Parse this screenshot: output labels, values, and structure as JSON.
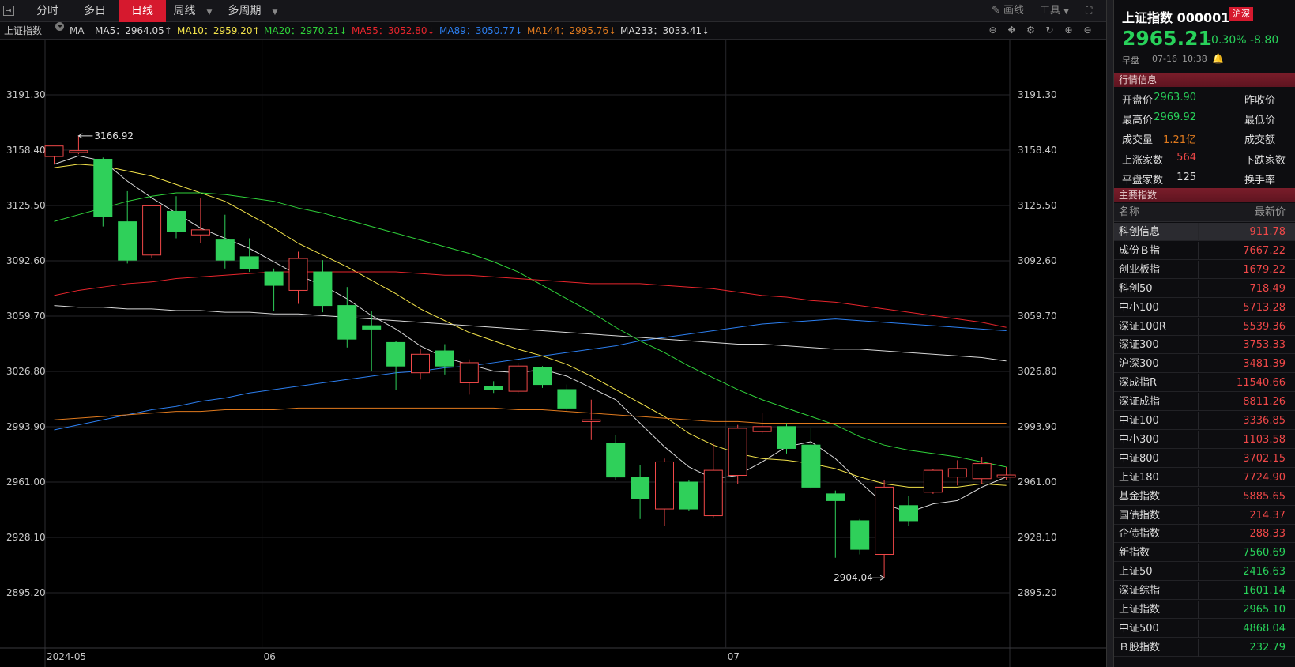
{
  "toolbar": {
    "tabs": [
      {
        "label": "分时",
        "active": false
      },
      {
        "label": "多日",
        "active": false
      },
      {
        "label": "日线",
        "active": true
      },
      {
        "label": "周线",
        "active": false
      },
      {
        "label": "多周期",
        "active": false
      }
    ],
    "draw_label": "画线",
    "tools_label": "工具"
  },
  "mabar": {
    "index_name": "上证指数",
    "ma_label": "MA",
    "items": [
      {
        "label": "MA5：2964.05↑",
        "color": "#d8d8d8",
        "arrow": "up"
      },
      {
        "label": "MA10：2959.20↑",
        "color": "#f2e24a",
        "arrow": "up"
      },
      {
        "label": "MA20：2970.21↓",
        "color": "#2fd23a",
        "arrow": "down"
      },
      {
        "label": "MA55：3052.80↓",
        "color": "#e8252c",
        "arrow": "down"
      },
      {
        "label": "MA89：3050.77↓",
        "color": "#2c7ff0",
        "arrow": "down"
      },
      {
        "label": "MA144：2995.76↓",
        "color": "#e07a1e",
        "arrow": "down"
      },
      {
        "label": "MA233：3033.41↓",
        "color": "#d8d8d8",
        "arrow": "down"
      }
    ]
  },
  "chart_data": {
    "type": "candlestick",
    "ylim": [
      2862.3,
      3224.2
    ],
    "y_ticks": [
      "3191.30",
      "3158.40",
      "3125.50",
      "3092.60",
      "3059.70",
      "3026.80",
      "2993.90",
      "2961.00",
      "2928.10",
      "2895.20"
    ],
    "y_tick_values": [
      3191.3,
      3158.4,
      3125.5,
      3092.6,
      3059.7,
      3026.8,
      2993.9,
      2961.0,
      2928.1,
      2895.2
    ],
    "x_labels": [
      {
        "label": "2024-05",
        "index": 0
      },
      {
        "label": "06",
        "index": 9
      },
      {
        "label": "07",
        "index": 28
      }
    ],
    "max_annotation": {
      "label": "3166.92",
      "index": 1,
      "value": 3166.92
    },
    "min_annotation": {
      "label": "2904.04",
      "index": 34,
      "value": 2904.04
    },
    "candles": [
      {
        "o": 3154.6,
        "c": 3160.9,
        "h": 3161.0,
        "l": 3150.1
      },
      {
        "o": 3157.0,
        "c": 3158.1,
        "h": 3166.92,
        "l": 3156.0
      },
      {
        "o": 3153.0,
        "c": 3119.0,
        "h": 3154.0,
        "l": 3113.0
      },
      {
        "o": 3115.8,
        "c": 3093.0,
        "h": 3134.0,
        "l": 3091.0
      },
      {
        "o": 3096.0,
        "c": 3125.3,
        "h": 3125.8,
        "l": 3094.0
      },
      {
        "o": 3122.0,
        "c": 3110.0,
        "h": 3131.0,
        "l": 3106.0
      },
      {
        "o": 3108.0,
        "c": 3111.0,
        "h": 3130.0,
        "l": 3103.0
      },
      {
        "o": 3105.0,
        "c": 3093.0,
        "h": 3120.0,
        "l": 3088.0
      },
      {
        "o": 3095.0,
        "c": 3088.0,
        "h": 3106.0,
        "l": 3086.0
      },
      {
        "o": 3086.0,
        "c": 3078.0,
        "h": 3088.0,
        "l": 3063.0
      },
      {
        "o": 3075.0,
        "c": 3094.0,
        "h": 3098.0,
        "l": 3067.0
      },
      {
        "o": 3086.0,
        "c": 3066.0,
        "h": 3093.0,
        "l": 3062.0
      },
      {
        "o": 3066.0,
        "c": 3046.0,
        "h": 3077.0,
        "l": 3041.0
      },
      {
        "o": 3054.0,
        "c": 3052.0,
        "h": 3063.0,
        "l": 3027.0
      },
      {
        "o": 3044.0,
        "c": 3030.0,
        "h": 3045.0,
        "l": 3016.0
      },
      {
        "o": 3026.0,
        "c": 3037.0,
        "h": 3040.0,
        "l": 3022.0
      },
      {
        "o": 3039.0,
        "c": 3030.0,
        "h": 3043.0,
        "l": 3025.0
      },
      {
        "o": 3020.0,
        "c": 3032.0,
        "h": 3034.0,
        "l": 3013.0
      },
      {
        "o": 3018.0,
        "c": 3016.0,
        "h": 3021.0,
        "l": 3014.0
      },
      {
        "o": 3015.0,
        "c": 3030.0,
        "h": 3032.0,
        "l": 3014.0
      },
      {
        "o": 3029.0,
        "c": 3019.0,
        "h": 3030.0,
        "l": 3017.0
      },
      {
        "o": 3016.0,
        "c": 3005.0,
        "h": 3019.0,
        "l": 3003.0
      },
      {
        "o": 2997.0,
        "c": 2998.0,
        "h": 3010.0,
        "l": 2986.0
      },
      {
        "o": 2984.0,
        "c": 2964.0,
        "h": 2989.0,
        "l": 2962.0
      },
      {
        "o": 2964.0,
        "c": 2951.0,
        "h": 2971.0,
        "l": 2939.0
      },
      {
        "o": 2945.0,
        "c": 2973.0,
        "h": 2975.0,
        "l": 2935.0
      },
      {
        "o": 2961.0,
        "c": 2945.0,
        "h": 2962.0,
        "l": 2944.0
      },
      {
        "o": 2941.0,
        "c": 2968.0,
        "h": 2984.0,
        "l": 2940.0
      },
      {
        "o": 2965.0,
        "c": 2993.0,
        "h": 2995.0,
        "l": 2960.0
      },
      {
        "o": 2991.0,
        "c": 2994.0,
        "h": 3002.0,
        "l": 2990.0
      },
      {
        "o": 2994.0,
        "c": 2981.0,
        "h": 2996.0,
        "l": 2978.0
      },
      {
        "o": 2983.0,
        "c": 2958.0,
        "h": 2993.0,
        "l": 2957.0
      },
      {
        "o": 2954.0,
        "c": 2950.0,
        "h": 2956.0,
        "l": 2916.0
      },
      {
        "o": 2938.0,
        "c": 2921.0,
        "h": 2939.0,
        "l": 2918.0
      },
      {
        "o": 2918.0,
        "c": 2958.0,
        "h": 2962.0,
        "l": 2904.04
      },
      {
        "o": 2947.0,
        "c": 2938.0,
        "h": 2953.0,
        "l": 2935.0
      },
      {
        "o": 2955.0,
        "c": 2968.0,
        "h": 2969.0,
        "l": 2954.0
      },
      {
        "o": 2964.0,
        "c": 2969.0,
        "h": 2974.0,
        "l": 2959.0
      },
      {
        "o": 2963.0,
        "c": 2972.0,
        "h": 2976.0,
        "l": 2960.0
      },
      {
        "o": 2963.9,
        "c": 2965.21,
        "h": 2969.92,
        "l": 2962.0
      }
    ],
    "ma_lines": [
      {
        "name": "MA5",
        "color": "#d8d8d8",
        "values": [
          3150,
          3155,
          3152,
          3140,
          3130,
          3121,
          3112,
          3106,
          3100,
          3092,
          3084,
          3078,
          3070,
          3060,
          3052,
          3042,
          3035,
          3031,
          3027,
          3026,
          3028,
          3024,
          3017,
          3010,
          2996,
          2982,
          2970,
          2963,
          2965,
          2973,
          2982,
          2985,
          2975,
          2961,
          2948,
          2943,
          2948,
          2950,
          2958,
          2964
        ]
      },
      {
        "name": "MA10",
        "color": "#f2e24a",
        "values": [
          3148,
          3150,
          3149,
          3146,
          3143,
          3138,
          3133,
          3128,
          3120,
          3112,
          3103,
          3096,
          3089,
          3081,
          3073,
          3064,
          3057,
          3050,
          3045,
          3040,
          3036,
          3031,
          3024,
          3016,
          3008,
          3000,
          2990,
          2983,
          2978,
          2975,
          2974,
          2972,
          2969,
          2964,
          2960,
          2958,
          2958,
          2958,
          2960,
          2959
        ]
      },
      {
        "name": "MA20",
        "color": "#2fd23a",
        "values": [
          3116,
          3120,
          3124,
          3128,
          3131,
          3133,
          3133,
          3132,
          3130,
          3128,
          3124,
          3121,
          3117,
          3113,
          3109,
          3105,
          3101,
          3097,
          3092,
          3086,
          3078,
          3070,
          3062,
          3053,
          3045,
          3038,
          3030,
          3023,
          3016,
          3010,
          3005,
          3000,
          2995,
          2988,
          2983,
          2980,
          2978,
          2976,
          2973,
          2970
        ]
      },
      {
        "name": "MA55",
        "color": "#e8252c",
        "values": [
          3072,
          3075,
          3077,
          3079,
          3080,
          3082,
          3083,
          3084,
          3085,
          3086,
          3086,
          3086,
          3086,
          3086,
          3086,
          3085,
          3084,
          3084,
          3083,
          3082,
          3081,
          3080,
          3079,
          3079,
          3079,
          3078,
          3077,
          3076,
          3074,
          3072,
          3071,
          3069,
          3068,
          3066,
          3064,
          3062,
          3060,
          3058,
          3056,
          3053
        ]
      },
      {
        "name": "MA89",
        "color": "#2c7ff0",
        "values": [
          2992,
          2995,
          2998,
          3001,
          3004,
          3006,
          3009,
          3011,
          3014,
          3016,
          3018,
          3020,
          3022,
          3024,
          3026,
          3027,
          3029,
          3030,
          3032,
          3034,
          3036,
          3038,
          3040,
          3042,
          3045,
          3047,
          3049,
          3051,
          3053,
          3055,
          3056,
          3057,
          3058,
          3057,
          3056,
          3055,
          3054,
          3053,
          3052,
          3051
        ]
      },
      {
        "name": "MA144",
        "color": "#e07a1e",
        "values": [
          2998,
          2999,
          3000,
          3001,
          3002,
          3003,
          3003,
          3004,
          3004,
          3004,
          3005,
          3005,
          3005,
          3005,
          3005,
          3005,
          3005,
          3005,
          3005,
          3004,
          3004,
          3003,
          3002,
          3001,
          3000,
          2999,
          2998,
          2997,
          2997,
          2996,
          2996,
          2996,
          2996,
          2996,
          2996,
          2996,
          2996,
          2996,
          2996,
          2996
        ]
      },
      {
        "name": "MA233",
        "color": "#d8d8d8",
        "values": [
          3066,
          3065,
          3065,
          3064,
          3064,
          3063,
          3063,
          3062,
          3062,
          3061,
          3061,
          3060,
          3059,
          3058,
          3057,
          3056,
          3055,
          3054,
          3053,
          3052,
          3051,
          3050,
          3049,
          3048,
          3047,
          3046,
          3045,
          3044,
          3043,
          3043,
          3042,
          3041,
          3040,
          3040,
          3039,
          3038,
          3037,
          3036,
          3035,
          3033
        ]
      }
    ]
  },
  "panel": {
    "name": "上证指数 000001",
    "badge": "沪深",
    "price": "2965.21",
    "change_pct": "-0.30%",
    "change_abs": "-8.80",
    "session": "早盘",
    "date": "07-16",
    "time": "10:38",
    "section_quote": "行情信息",
    "quote": [
      {
        "label": "开盘价",
        "value": "2963.90",
        "color": "#28d25a",
        "label2": "昨收价"
      },
      {
        "label": "最高价",
        "value": "2969.92",
        "color": "#28d25a",
        "label2": "最低价"
      },
      {
        "label": "成交量",
        "value": "1.21亿",
        "color": "#e07a1e",
        "label2": "成交额"
      },
      {
        "label": "上涨家数",
        "value": "564",
        "color": "#f04848",
        "label2": "下跌家数"
      },
      {
        "label": "平盘家数",
        "value": "125",
        "color": "#dddddd",
        "label2": "换手率"
      }
    ],
    "section_index": "主要指数",
    "index_head_name": "名称",
    "index_head_price": "最新价",
    "indices": [
      {
        "name": "科创信息",
        "value": "911.78",
        "color": "#f04848"
      },
      {
        "name": "成份Ｂ指",
        "value": "7667.22",
        "color": "#f04848"
      },
      {
        "name": "创业板指",
        "value": "1679.22",
        "color": "#f04848"
      },
      {
        "name": "科创50",
        "value": "718.49",
        "color": "#f04848"
      },
      {
        "name": "中小100",
        "value": "5713.28",
        "color": "#f04848"
      },
      {
        "name": "深证100R",
        "value": "5539.36",
        "color": "#f04848"
      },
      {
        "name": "深证300",
        "value": "3753.33",
        "color": "#f04848"
      },
      {
        "name": "沪深300",
        "value": "3481.39",
        "color": "#f04848"
      },
      {
        "name": "深成指R",
        "value": "11540.66",
        "color": "#f04848"
      },
      {
        "name": "深证成指",
        "value": "8811.26",
        "color": "#f04848"
      },
      {
        "name": "中证100",
        "value": "3336.85",
        "color": "#f04848"
      },
      {
        "name": "中小300",
        "value": "1103.58",
        "color": "#f04848"
      },
      {
        "name": "中证800",
        "value": "3702.15",
        "color": "#f04848"
      },
      {
        "name": "上证180",
        "value": "7724.90",
        "color": "#f04848"
      },
      {
        "name": "基金指数",
        "value": "5885.65",
        "color": "#f04848"
      },
      {
        "name": "国债指数",
        "value": "214.37",
        "color": "#f04848"
      },
      {
        "name": "企债指数",
        "value": "288.33",
        "color": "#f04848"
      },
      {
        "name": "新指数",
        "value": "7560.69",
        "color": "#28d25a"
      },
      {
        "name": "上证50",
        "value": "2416.63",
        "color": "#28d25a"
      },
      {
        "name": "深证综指",
        "value": "1601.14",
        "color": "#28d25a"
      },
      {
        "name": "上证指数",
        "value": "2965.10",
        "color": "#28d25a"
      },
      {
        "name": "中证500",
        "value": "4868.04",
        "color": "#28d25a"
      },
      {
        "name": "Ｂ股指数",
        "value": "232.79",
        "color": "#28d25a"
      }
    ]
  },
  "colors": {
    "up": "#f04848",
    "down": "#2fd05a",
    "accent": "#d6192e"
  }
}
